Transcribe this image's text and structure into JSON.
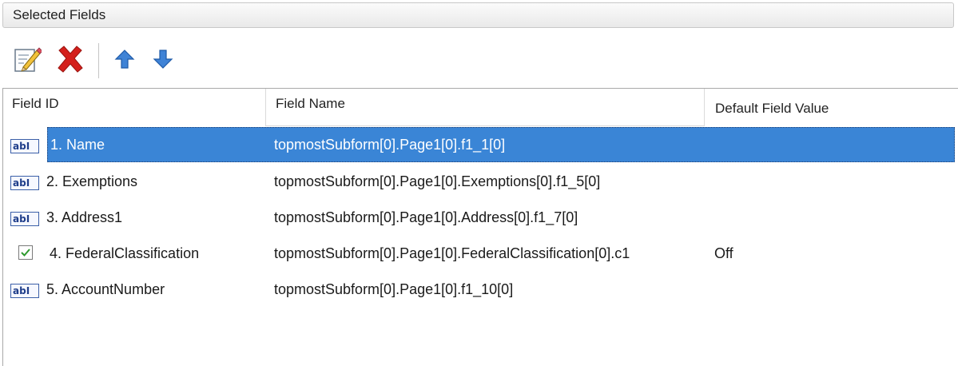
{
  "panel": {
    "title": "Selected Fields"
  },
  "toolbar": {
    "buttons": [
      {
        "name": "edit",
        "icon": "edit-icon"
      },
      {
        "name": "delete",
        "icon": "delete-icon"
      },
      {
        "name": "move-up",
        "icon": "arrow-up-icon"
      },
      {
        "name": "move-down",
        "icon": "arrow-down-icon"
      }
    ]
  },
  "grid": {
    "columns": [
      "Field ID",
      "Field Name",
      "Default Field Value"
    ],
    "rows": [
      {
        "id": "1. Name",
        "name": "topmostSubform[0].Page1[0].f1_1[0]",
        "value": "",
        "type_icon": "text-field-icon",
        "type_label": "ab",
        "selected": true
      },
      {
        "id": "2. Exemptions",
        "name": "topmostSubform[0].Page1[0].Exemptions[0].f1_5[0]",
        "value": "",
        "type_icon": "text-field-icon",
        "type_label": "ab"
      },
      {
        "id": "3. Address1",
        "name": "topmostSubform[0].Page1[0].Address[0].f1_7[0]",
        "value": "",
        "type_icon": "text-field-icon",
        "type_label": "ab"
      },
      {
        "id": "4. FederalClassification",
        "name": "topmostSubform[0].Page1[0].FederalClassification[0].c1",
        "value": "Off",
        "type_icon": "checkbox-icon"
      },
      {
        "id": "5. AccountNumber",
        "name": "topmostSubform[0].Page1[0].f1_10[0]",
        "value": "",
        "type_icon": "text-field-icon",
        "type_label": "ab"
      }
    ]
  },
  "colors": {
    "selection": "#3a85d6",
    "red_x": "#d4201c",
    "arrow_blue": "#3f83d6",
    "checkmark": "#2e9a2e"
  }
}
